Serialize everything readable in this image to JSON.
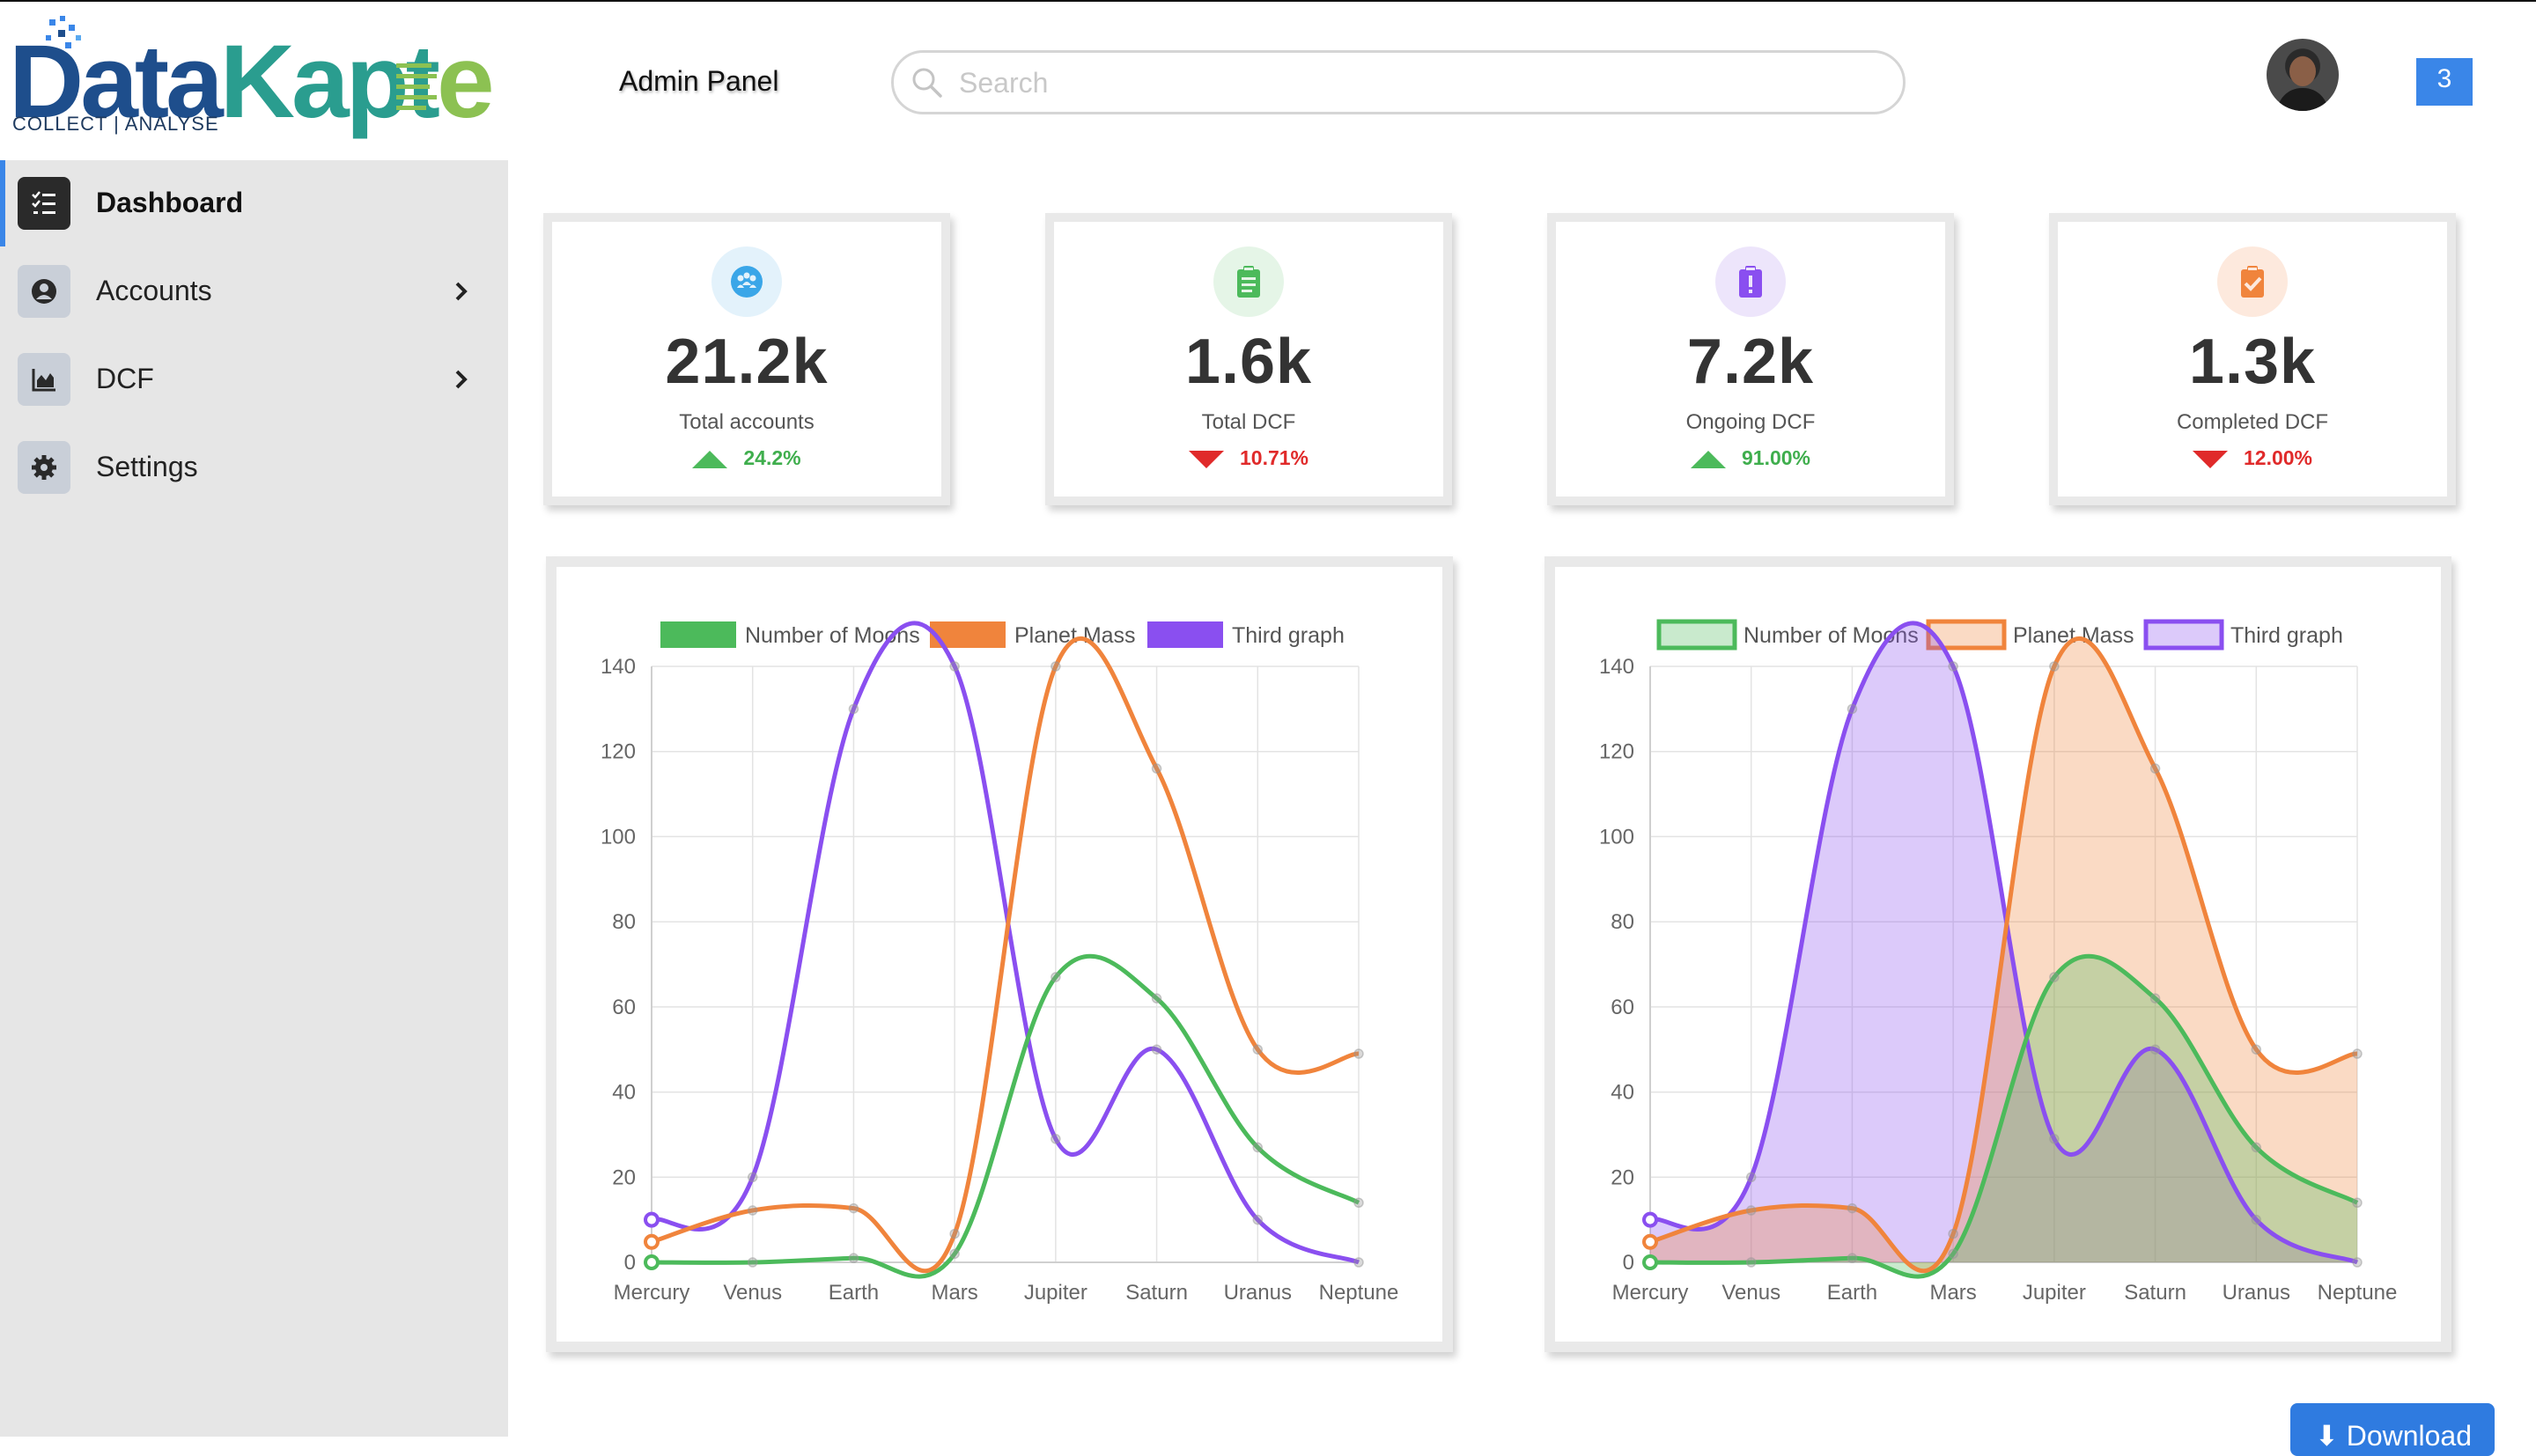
{
  "header": {
    "logo": {
      "part1": "Data",
      "part2": "Kapt",
      "part3": "e",
      "tagline": "COLLECT | ANALYSE"
    },
    "title": "Admin Panel",
    "search": {
      "placeholder": "Search",
      "value": ""
    },
    "notification_count": "3"
  },
  "sidebar": {
    "items": [
      {
        "label": "Dashboard",
        "icon": "list-check-icon",
        "active": true
      },
      {
        "label": "Accounts",
        "icon": "user-circle-icon",
        "has_submenu": true
      },
      {
        "label": "DCF",
        "icon": "area-chart-icon",
        "has_submenu": true
      },
      {
        "label": "Settings",
        "icon": "gear-icon"
      }
    ]
  },
  "stats": [
    {
      "value": "21.2k",
      "label": "Total accounts",
      "change": "24.2%",
      "direction": "up",
      "icon": "team-icon",
      "color": "#3aa6e8"
    },
    {
      "value": "1.6k",
      "label": "Total DCF",
      "change": "10.71%",
      "direction": "down",
      "icon": "clipboard-list-icon",
      "color": "#4cba5b"
    },
    {
      "value": "7.2k",
      "label": "Ongoing DCF",
      "change": "91.00%",
      "direction": "up",
      "icon": "alert-clipboard-icon",
      "color": "#8a4ff0"
    },
    {
      "value": "1.3k",
      "label": "Completed DCF",
      "change": "12.00%",
      "direction": "down",
      "icon": "check-clipboard-icon",
      "color": "#f0843c"
    }
  ],
  "chart_data": [
    {
      "type": "line",
      "categories": [
        "Mercury",
        "Venus",
        "Earth",
        "Mars",
        "Jupiter",
        "Saturn",
        "Uranus",
        "Neptune"
      ],
      "ylim": [
        0,
        140
      ],
      "yticks": [
        0,
        20,
        40,
        60,
        80,
        100,
        120,
        140
      ],
      "grid": true,
      "legend": "top",
      "filled": false,
      "series": [
        {
          "name": "Number of Moons",
          "color": "#4cba5b",
          "values": [
            0,
            0,
            1,
            2,
            67,
            62,
            27,
            14
          ]
        },
        {
          "name": "Planet Mass",
          "color": "#f0843c",
          "values": [
            4.8,
            12.2,
            12.7,
            6.7,
            140,
            116,
            50,
            49
          ]
        },
        {
          "name": "Third graph",
          "color": "#8a4ff0",
          "values": [
            10,
            20,
            130,
            140,
            29,
            50,
            10,
            0
          ]
        }
      ]
    },
    {
      "type": "area",
      "categories": [
        "Mercury",
        "Venus",
        "Earth",
        "Mars",
        "Jupiter",
        "Saturn",
        "Uranus",
        "Neptune"
      ],
      "ylim": [
        0,
        140
      ],
      "yticks": [
        0,
        20,
        40,
        60,
        80,
        100,
        120,
        140
      ],
      "grid": true,
      "legend": "top",
      "filled": true,
      "series": [
        {
          "name": "Number of Moons",
          "color": "#4cba5b",
          "values": [
            0,
            0,
            1,
            2,
            67,
            62,
            27,
            14
          ]
        },
        {
          "name": "Planet Mass",
          "color": "#f0843c",
          "values": [
            4.8,
            12.2,
            12.7,
            6.7,
            140,
            116,
            50,
            49
          ]
        },
        {
          "name": "Third graph",
          "color": "#8a4ff0",
          "values": [
            10,
            20,
            130,
            140,
            29,
            50,
            10,
            0
          ]
        }
      ]
    }
  ],
  "download_label": "⬇ Download"
}
